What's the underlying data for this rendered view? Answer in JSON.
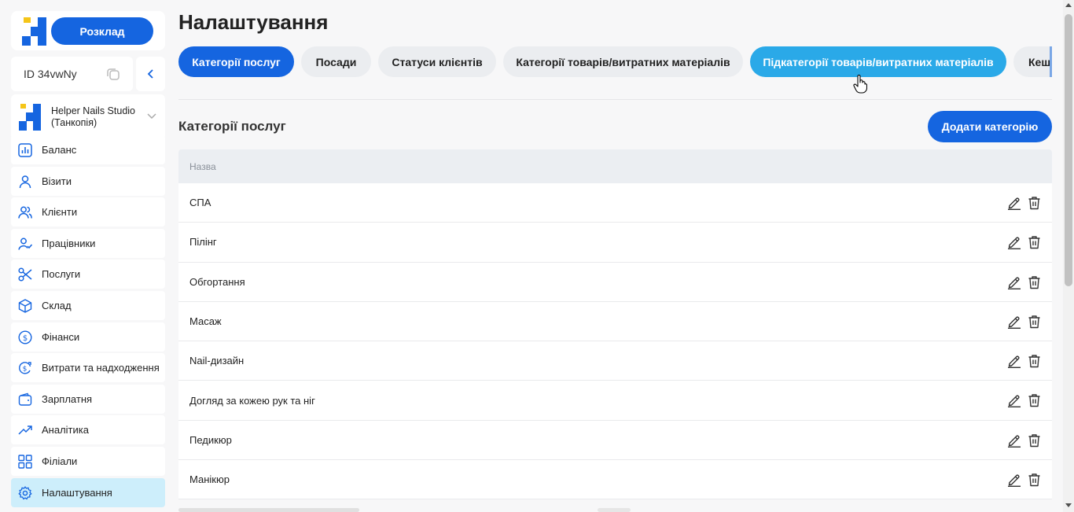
{
  "sidebar": {
    "schedule_label": "Розклад",
    "id_label": "ID 34vwNy",
    "studio_name": "Helper Nails Studio (Танкопія)",
    "items": [
      {
        "label": "Баланс",
        "icon": "bar-chart-icon"
      },
      {
        "label": "Візити",
        "icon": "user-icon"
      },
      {
        "label": "Клієнти",
        "icon": "users-icon"
      },
      {
        "label": "Працівники",
        "icon": "user-check-icon"
      },
      {
        "label": "Послуги",
        "icon": "scissors-icon"
      },
      {
        "label": "Склад",
        "icon": "box-icon"
      },
      {
        "label": "Фінанси",
        "icon": "dollar-circle-icon"
      },
      {
        "label": "Витрати та надходження",
        "icon": "dollar-refresh-icon"
      },
      {
        "label": "Зарплатня",
        "icon": "wallet-icon"
      },
      {
        "label": "Аналітика",
        "icon": "trend-up-icon"
      },
      {
        "label": "Філіали",
        "icon": "grid-icon"
      },
      {
        "label": "Налаштування",
        "icon": "gear-icon",
        "active": true
      }
    ]
  },
  "main": {
    "title": "Налаштування",
    "tabs": [
      {
        "label": "Категорії послуг",
        "state": "active"
      },
      {
        "label": "Посади",
        "state": "normal"
      },
      {
        "label": "Статуси клієнтів",
        "state": "normal"
      },
      {
        "label": "Категорії товарів/витратних матеріалів",
        "state": "normal"
      },
      {
        "label": "Підкатегорії товарів/витратних матеріалів",
        "state": "hover"
      },
      {
        "label": "Кеш",
        "state": "normal"
      }
    ],
    "section_title": "Категорії послуг",
    "add_button_label": "Додати категорію",
    "table": {
      "header_name": "Назва",
      "rows": [
        "СПА",
        "Пілінг",
        "Обгортання",
        "Масаж",
        "Nail-дизайн",
        "Догляд за кожею рук та ніг",
        "Педикюр",
        "Манікюр"
      ]
    }
  },
  "colors": {
    "primary": "#1565e0",
    "hover_tab": "#2aa9e8",
    "active_nav": "#cdeefb",
    "logo_yellow": "#f5c518"
  }
}
